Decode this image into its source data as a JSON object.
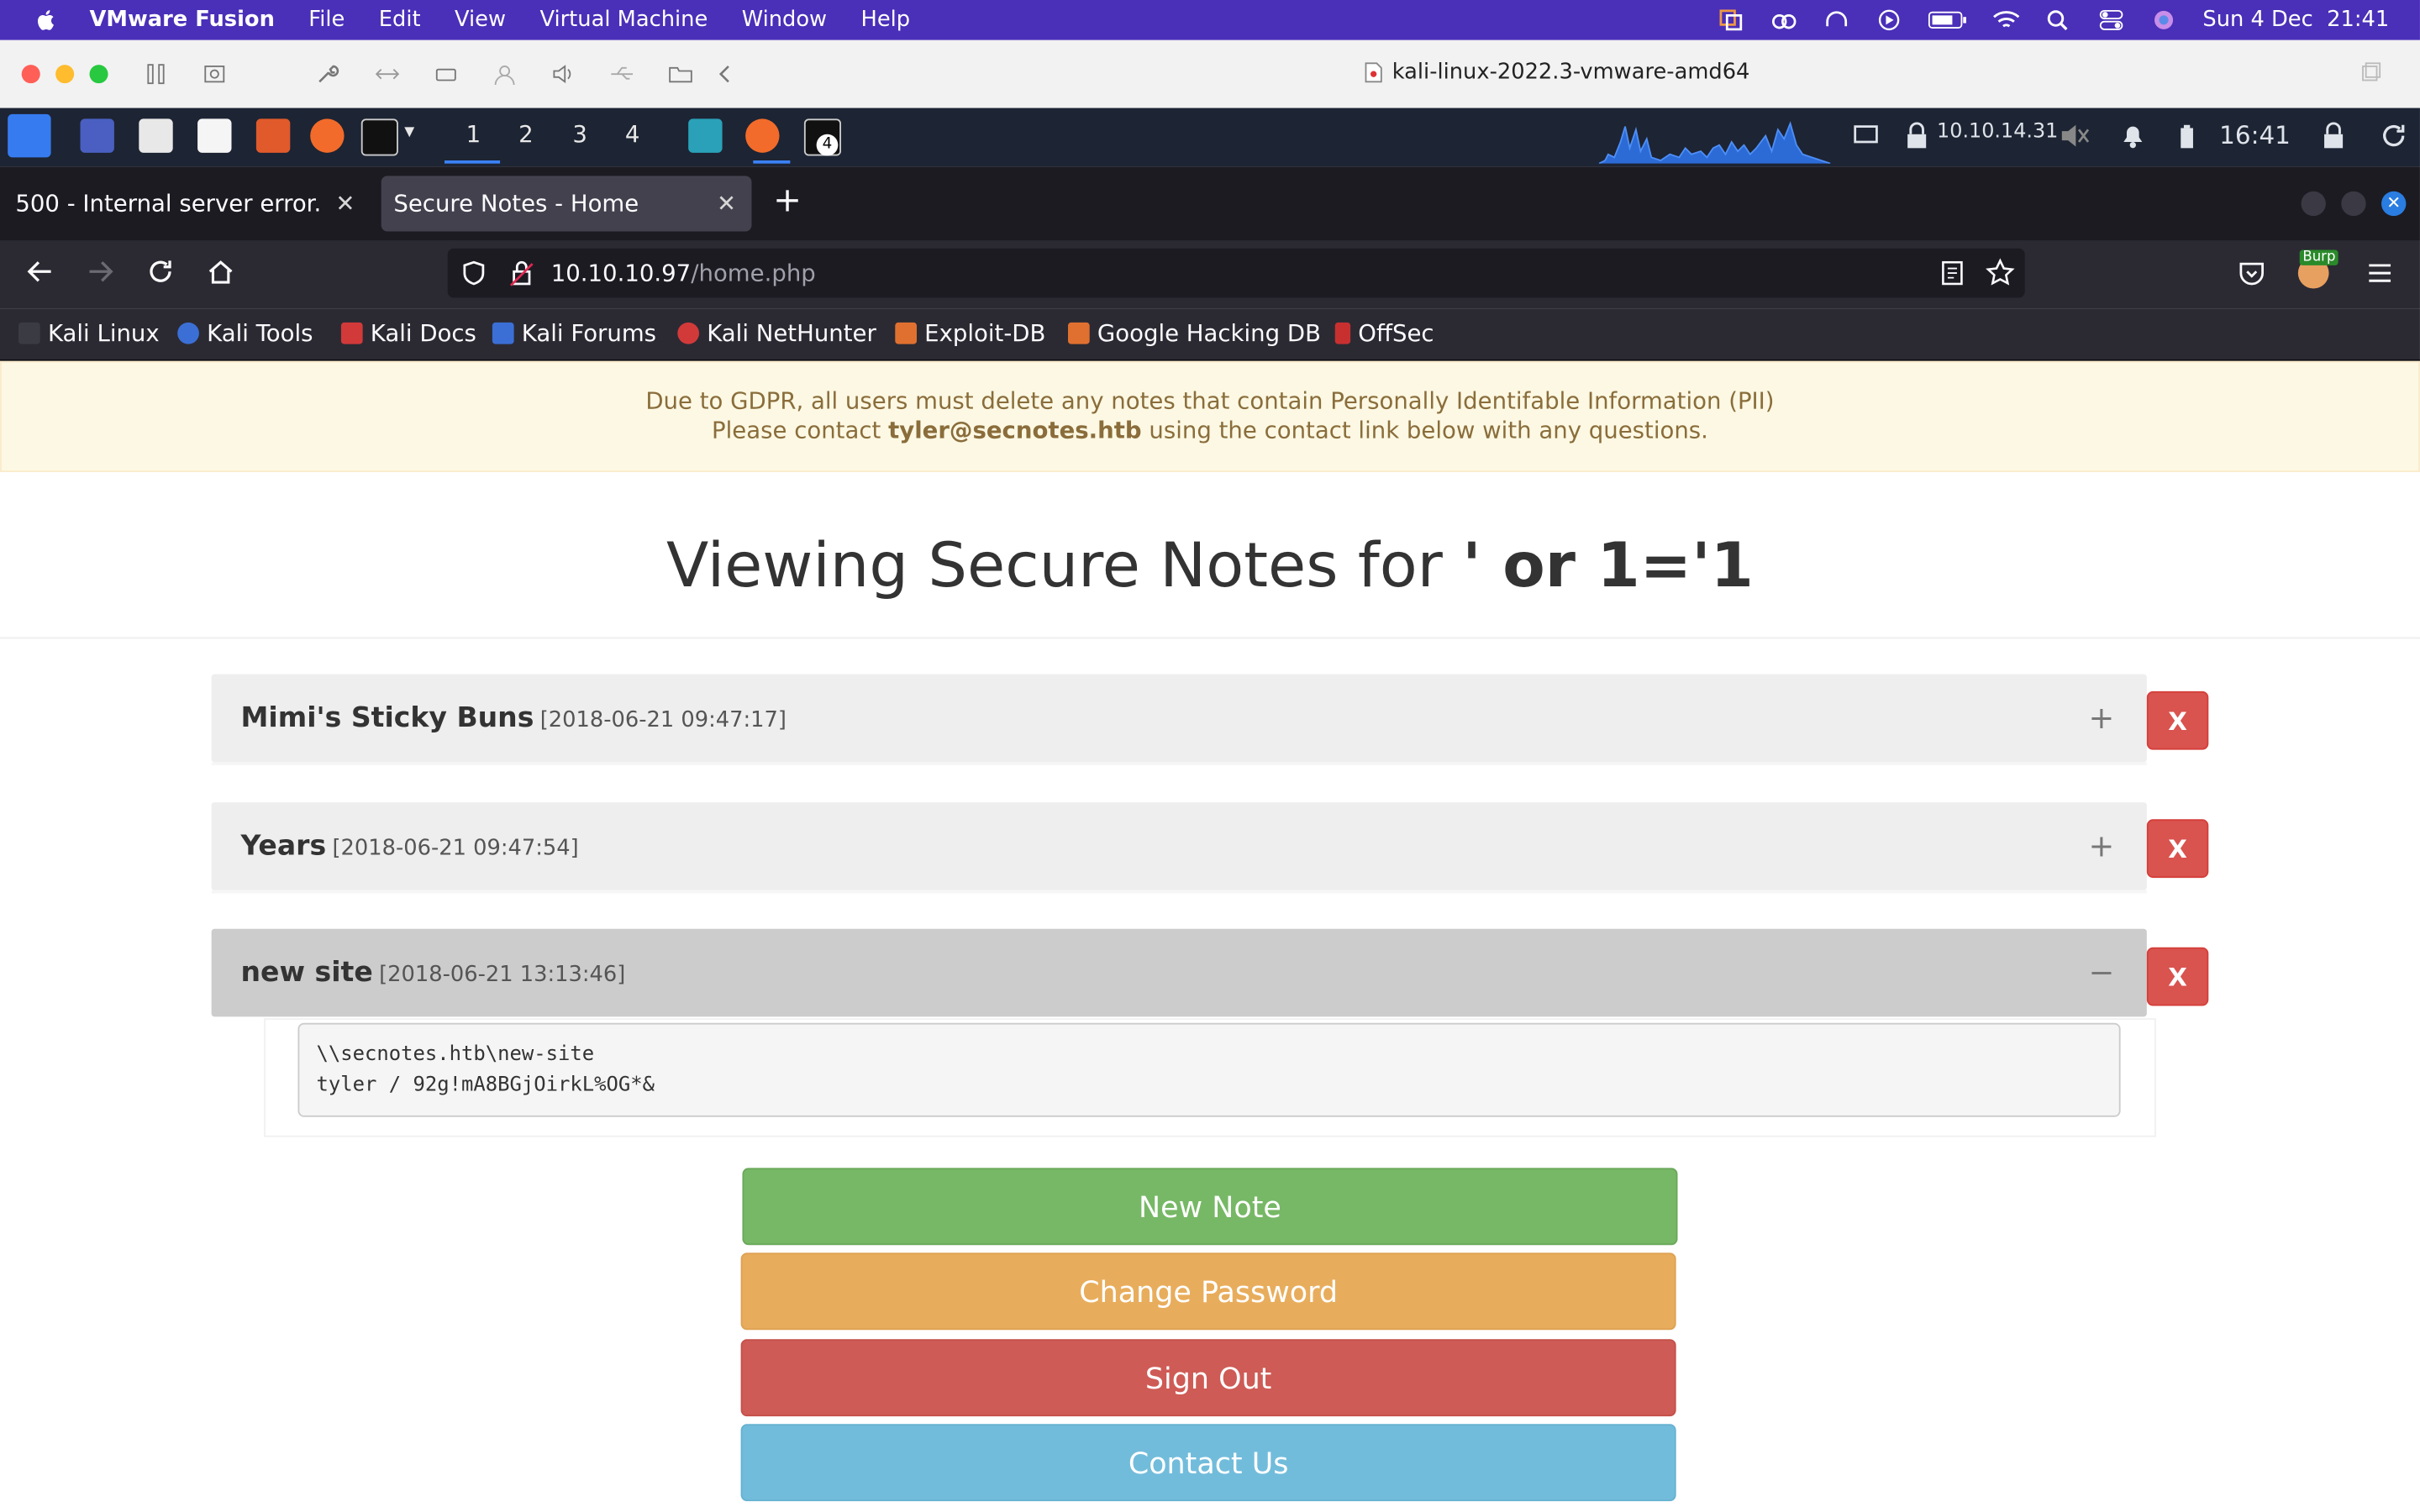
{
  "menubar": {
    "app": "VMware Fusion",
    "items": [
      "File",
      "Edit",
      "View",
      "Virtual Machine",
      "Window",
      "Help"
    ],
    "clock": "Sun 4 Dec  21:41"
  },
  "vmware": {
    "window_title": "kali-linux-2022.3-vmware-amd64"
  },
  "kali_panel": {
    "workspaces": [
      "1",
      "2",
      "3",
      "4"
    ],
    "terminal_badge": "4",
    "ip": "10.10.14.31",
    "time": "16:41"
  },
  "browser": {
    "tabs": [
      {
        "title": "500 - Internal server error."
      },
      {
        "title": "Secure Notes - Home"
      }
    ],
    "url_host": "10.10.10.97",
    "url_path": "/home.php",
    "burp_badge": "Burp",
    "bookmarks": [
      "Kali Linux",
      "Kali Tools",
      "Kali Docs",
      "Kali Forums",
      "Kali NetHunter",
      "Exploit-DB",
      "Google Hacking DB",
      "OffSec"
    ]
  },
  "page": {
    "alert_line1": "Due to GDPR, all users must delete any notes that contain Personally Identifable Information (PII)",
    "alert_line2_pre": "Please contact ",
    "alert_email": "tyler@secnotes.htb",
    "alert_line2_post": " using the contact link below with any questions.",
    "heading_pre": "Viewing Secure Notes for ",
    "heading_user": "' or 1='1",
    "notes": [
      {
        "title": "Mimi's Sticky Buns",
        "date": "[2018-06-21 09:47:17]",
        "toggle": "+",
        "delete": "X"
      },
      {
        "title": "Years",
        "date": "[2018-06-21 09:47:54]",
        "toggle": "+",
        "delete": "X"
      },
      {
        "title": "new site",
        "date": "[2018-06-21 13:13:46]",
        "toggle": "−",
        "delete": "X"
      }
    ],
    "open_note_line1": "\\\\secnotes.htb\\new-site",
    "open_note_line2": "tyler / 92g!mA8BGjOirkL%OG*&",
    "buttons": {
      "new_note": "New Note",
      "change_password": "Change Password",
      "sign_out": "Sign Out",
      "contact_us": "Contact Us"
    }
  },
  "colors": {
    "menubar": "#4a2fb8",
    "new_note": "#77b866",
    "change_password": "#e8ad5c",
    "sign_out": "#ce5b55",
    "contact_us": "#72bcdb",
    "delete": "#d9534f"
  }
}
